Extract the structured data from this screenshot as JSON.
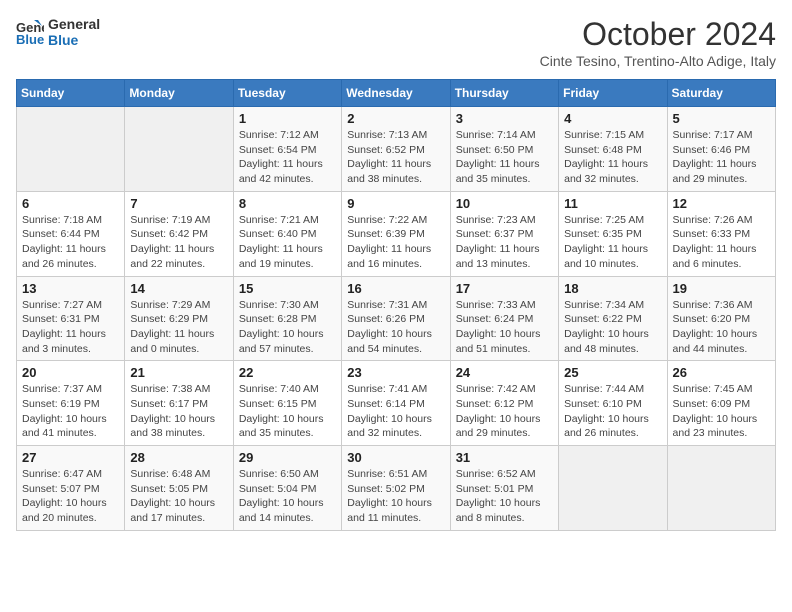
{
  "header": {
    "logo_line1": "General",
    "logo_line2": "Blue",
    "month": "October 2024",
    "location": "Cinte Tesino, Trentino-Alto Adige, Italy"
  },
  "days_of_week": [
    "Sunday",
    "Monday",
    "Tuesday",
    "Wednesday",
    "Thursday",
    "Friday",
    "Saturday"
  ],
  "weeks": [
    [
      {
        "num": "",
        "info": ""
      },
      {
        "num": "",
        "info": ""
      },
      {
        "num": "1",
        "info": "Sunrise: 7:12 AM\nSunset: 6:54 PM\nDaylight: 11 hours and 42 minutes."
      },
      {
        "num": "2",
        "info": "Sunrise: 7:13 AM\nSunset: 6:52 PM\nDaylight: 11 hours and 38 minutes."
      },
      {
        "num": "3",
        "info": "Sunrise: 7:14 AM\nSunset: 6:50 PM\nDaylight: 11 hours and 35 minutes."
      },
      {
        "num": "4",
        "info": "Sunrise: 7:15 AM\nSunset: 6:48 PM\nDaylight: 11 hours and 32 minutes."
      },
      {
        "num": "5",
        "info": "Sunrise: 7:17 AM\nSunset: 6:46 PM\nDaylight: 11 hours and 29 minutes."
      }
    ],
    [
      {
        "num": "6",
        "info": "Sunrise: 7:18 AM\nSunset: 6:44 PM\nDaylight: 11 hours and 26 minutes."
      },
      {
        "num": "7",
        "info": "Sunrise: 7:19 AM\nSunset: 6:42 PM\nDaylight: 11 hours and 22 minutes."
      },
      {
        "num": "8",
        "info": "Sunrise: 7:21 AM\nSunset: 6:40 PM\nDaylight: 11 hours and 19 minutes."
      },
      {
        "num": "9",
        "info": "Sunrise: 7:22 AM\nSunset: 6:39 PM\nDaylight: 11 hours and 16 minutes."
      },
      {
        "num": "10",
        "info": "Sunrise: 7:23 AM\nSunset: 6:37 PM\nDaylight: 11 hours and 13 minutes."
      },
      {
        "num": "11",
        "info": "Sunrise: 7:25 AM\nSunset: 6:35 PM\nDaylight: 11 hours and 10 minutes."
      },
      {
        "num": "12",
        "info": "Sunrise: 7:26 AM\nSunset: 6:33 PM\nDaylight: 11 hours and 6 minutes."
      }
    ],
    [
      {
        "num": "13",
        "info": "Sunrise: 7:27 AM\nSunset: 6:31 PM\nDaylight: 11 hours and 3 minutes."
      },
      {
        "num": "14",
        "info": "Sunrise: 7:29 AM\nSunset: 6:29 PM\nDaylight: 11 hours and 0 minutes."
      },
      {
        "num": "15",
        "info": "Sunrise: 7:30 AM\nSunset: 6:28 PM\nDaylight: 10 hours and 57 minutes."
      },
      {
        "num": "16",
        "info": "Sunrise: 7:31 AM\nSunset: 6:26 PM\nDaylight: 10 hours and 54 minutes."
      },
      {
        "num": "17",
        "info": "Sunrise: 7:33 AM\nSunset: 6:24 PM\nDaylight: 10 hours and 51 minutes."
      },
      {
        "num": "18",
        "info": "Sunrise: 7:34 AM\nSunset: 6:22 PM\nDaylight: 10 hours and 48 minutes."
      },
      {
        "num": "19",
        "info": "Sunrise: 7:36 AM\nSunset: 6:20 PM\nDaylight: 10 hours and 44 minutes."
      }
    ],
    [
      {
        "num": "20",
        "info": "Sunrise: 7:37 AM\nSunset: 6:19 PM\nDaylight: 10 hours and 41 minutes."
      },
      {
        "num": "21",
        "info": "Sunrise: 7:38 AM\nSunset: 6:17 PM\nDaylight: 10 hours and 38 minutes."
      },
      {
        "num": "22",
        "info": "Sunrise: 7:40 AM\nSunset: 6:15 PM\nDaylight: 10 hours and 35 minutes."
      },
      {
        "num": "23",
        "info": "Sunrise: 7:41 AM\nSunset: 6:14 PM\nDaylight: 10 hours and 32 minutes."
      },
      {
        "num": "24",
        "info": "Sunrise: 7:42 AM\nSunset: 6:12 PM\nDaylight: 10 hours and 29 minutes."
      },
      {
        "num": "25",
        "info": "Sunrise: 7:44 AM\nSunset: 6:10 PM\nDaylight: 10 hours and 26 minutes."
      },
      {
        "num": "26",
        "info": "Sunrise: 7:45 AM\nSunset: 6:09 PM\nDaylight: 10 hours and 23 minutes."
      }
    ],
    [
      {
        "num": "27",
        "info": "Sunrise: 6:47 AM\nSunset: 5:07 PM\nDaylight: 10 hours and 20 minutes."
      },
      {
        "num": "28",
        "info": "Sunrise: 6:48 AM\nSunset: 5:05 PM\nDaylight: 10 hours and 17 minutes."
      },
      {
        "num": "29",
        "info": "Sunrise: 6:50 AM\nSunset: 5:04 PM\nDaylight: 10 hours and 14 minutes."
      },
      {
        "num": "30",
        "info": "Sunrise: 6:51 AM\nSunset: 5:02 PM\nDaylight: 10 hours and 11 minutes."
      },
      {
        "num": "31",
        "info": "Sunrise: 6:52 AM\nSunset: 5:01 PM\nDaylight: 10 hours and 8 minutes."
      },
      {
        "num": "",
        "info": ""
      },
      {
        "num": "",
        "info": ""
      }
    ]
  ]
}
